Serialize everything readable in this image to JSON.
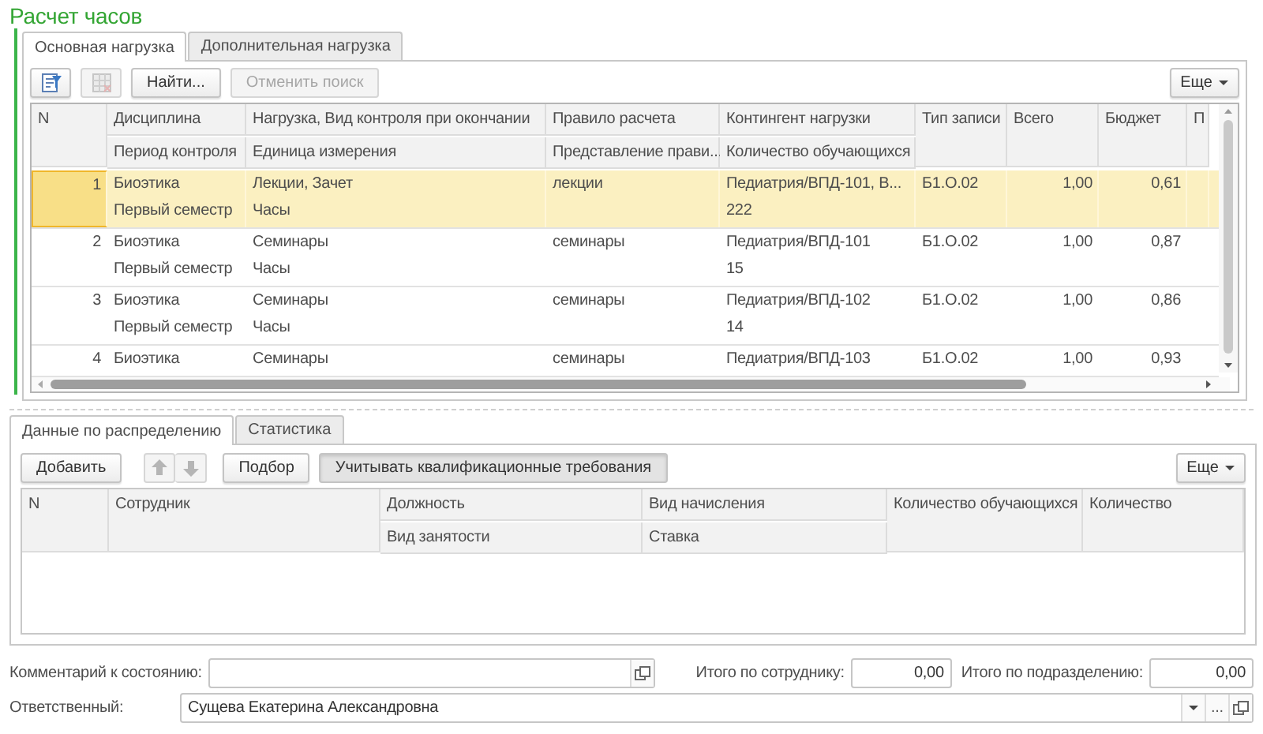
{
  "title": "Расчет часов",
  "main_tabs": [
    {
      "label": "Основная нагрузка",
      "selected": true
    },
    {
      "label": "Дополнительная нагрузка",
      "selected": false
    }
  ],
  "main_toolbar": {
    "icon_buttons": [
      {
        "disabled": false
      },
      {
        "disabled": true
      }
    ],
    "buttons": [
      {
        "label": "Найти...",
        "disabled": false
      },
      {
        "label": "Отменить поиск",
        "disabled": true
      }
    ],
    "more": "Еще"
  },
  "load_table": {
    "columns": [
      {
        "label": "N",
        "kind": "number"
      },
      {
        "label": "Дисциплина",
        "sublabel": "Период контроля",
        "kind": "text"
      },
      {
        "label": "Нагрузка, Вид контроля при окончании",
        "sublabel": "Единица измерения",
        "kind": "text"
      },
      {
        "label": "Правило расчета",
        "sublabel": "Представление прави...",
        "kind": "text"
      },
      {
        "label": "Контингент нагрузки",
        "sublabel": "Количество обучающихся",
        "kind": "text"
      },
      {
        "label": "Тип записи",
        "kind": "text"
      },
      {
        "label": "Всего",
        "kind": "number"
      },
      {
        "label": "Бюджет",
        "kind": "number"
      },
      {
        "label": "П",
        "kind": "text"
      }
    ],
    "rows": [
      {
        "selected": true,
        "cells": [
          [
            "1"
          ],
          [
            "Биоэтика",
            "Первый семестр"
          ],
          [
            "Лекции, Зачет",
            "Часы"
          ],
          [
            "лекции"
          ],
          [
            "Педиатрия/ВПД-101, В...",
            "222"
          ],
          [
            "Б1.О.02"
          ],
          [
            "1,00"
          ],
          [
            "0,61"
          ]
        ]
      },
      {
        "selected": false,
        "cells": [
          [
            "2"
          ],
          [
            "Биоэтика",
            "Первый семестр"
          ],
          [
            "Семинары",
            "Часы"
          ],
          [
            "семинары"
          ],
          [
            "Педиатрия/ВПД-101",
            "15"
          ],
          [
            "Б1.О.02"
          ],
          [
            "1,00"
          ],
          [
            "0,87"
          ]
        ]
      },
      {
        "selected": false,
        "cells": [
          [
            "3"
          ],
          [
            "Биоэтика",
            "Первый семестр"
          ],
          [
            "Семинары",
            "Часы"
          ],
          [
            "семинары"
          ],
          [
            "Педиатрия/ВПД-102",
            "14"
          ],
          [
            "Б1.О.02"
          ],
          [
            "1,00"
          ],
          [
            "0,86"
          ]
        ]
      },
      {
        "selected": false,
        "cells": [
          [
            "4"
          ],
          [
            "Биоэтика"
          ],
          [
            "Семинары"
          ],
          [
            "семинары"
          ],
          [
            "Педиатрия/ВПД-103"
          ],
          [
            "Б1.О.02"
          ],
          [
            "1,00"
          ],
          [
            "0,93"
          ]
        ]
      }
    ]
  },
  "distribution_tabs": [
    {
      "label": "Данные по распределению",
      "selected": true
    },
    {
      "label": "Статистика",
      "selected": false
    }
  ],
  "distribution_toolbar": {
    "add": "Добавить",
    "move_buttons": [
      {
        "disabled": true
      },
      {
        "disabled": true
      }
    ],
    "buttons": [
      {
        "label": "Подбор",
        "pressed": false
      },
      {
        "label": "Учитывать квалификационные требования",
        "pressed": true
      }
    ],
    "more": "Еще"
  },
  "distribution_table": {
    "columns": [
      {
        "label": "N"
      },
      {
        "label": "Сотрудник"
      },
      {
        "label": "Должность",
        "sublabel": "Вид занятости"
      },
      {
        "label": "Вид начисления",
        "sublabel": "Ставка"
      },
      {
        "label": "Количество обучающихся"
      },
      {
        "label": "Количество"
      }
    ]
  },
  "footer": {
    "comment_label": "Комментарий к состоянию:",
    "employee_total_label": "Итого по сотруднику:",
    "employee_total": "0,00",
    "department_total_label": "Итого по подразделению:",
    "department_total": "0,00",
    "responsible_label": "Ответственный:",
    "responsible": "Сущева Екатерина Александровна",
    "browse": "..."
  }
}
